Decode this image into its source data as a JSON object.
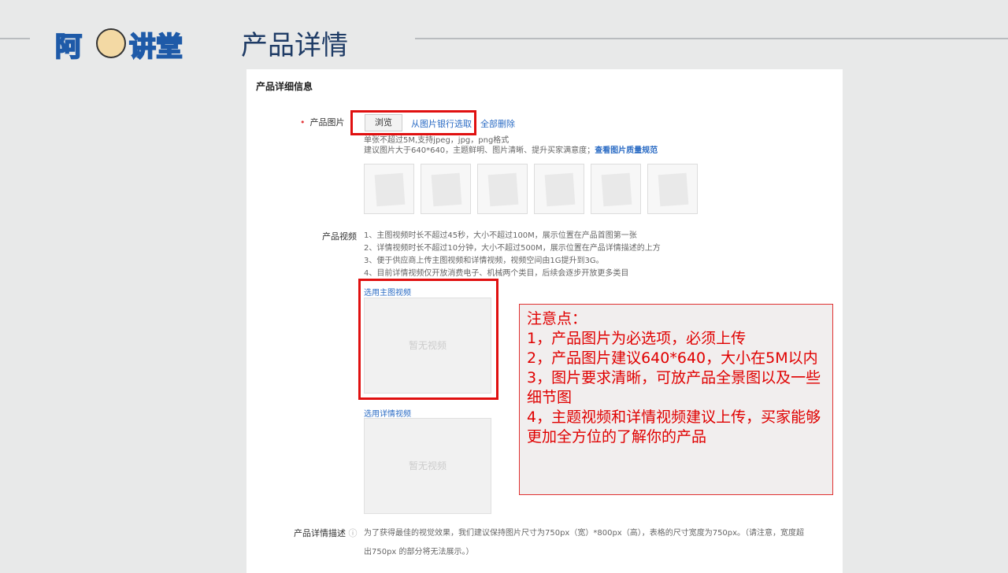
{
  "header": {
    "logo_text": "阿讲堂",
    "title": "产品详情"
  },
  "panel": {
    "section_title": "产品详细信息",
    "image": {
      "label": "产品图片",
      "browse": "浏览",
      "from_bank": "从图片银行选取",
      "delete_all": "全部删除",
      "hint1": "单张不超过5M,支持jpeg，jpg，png格式",
      "hint2": "建议图片大于640*640，主题鲜明、图片清晰、提升买家满意度；",
      "hint_link": "查看图片质量规范"
    },
    "video": {
      "label": "产品视频",
      "rules": [
        "1、主图视频时长不超过45秒，大小不超过100M，展示位置在产品首图第一张",
        "2、详情视频时长不超过10分钟，大小不超过500M，展示位置在产品详情描述的上方",
        "3、便于供应商上传主图视频和详情视频，视频空间由1G提升到3G。",
        "4、目前详情视频仅开放消费电子、机械两个类目，后续会逐步开放更多类目"
      ],
      "main_link": "选用主图视频",
      "detail_link": "选用详情视频",
      "empty": "暂无视频"
    },
    "desc": {
      "label": "产品详情描述",
      "text1": "为了获得最佳的视觉效果，我们建议保持图片尺寸为750px（宽）*800px（高），表格的尺寸宽度为750px。（请注意，宽度超",
      "text2": "出750px 的部分将无法展示。）"
    }
  },
  "note": {
    "lines": [
      "注意点：",
      "1，产品图片为必选项，必须上传",
      "2，产品图片建议640*640，大小在5M以内",
      "3，图片要求清晰，可放产品全景图以及一些细节图",
      "4，主题视频和详情视频建议上传，买家能够更加全方位的了解你的产品"
    ]
  },
  "colors": {
    "accent": "#e01010",
    "link": "#2a6bc4",
    "title": "#1f3c66"
  }
}
